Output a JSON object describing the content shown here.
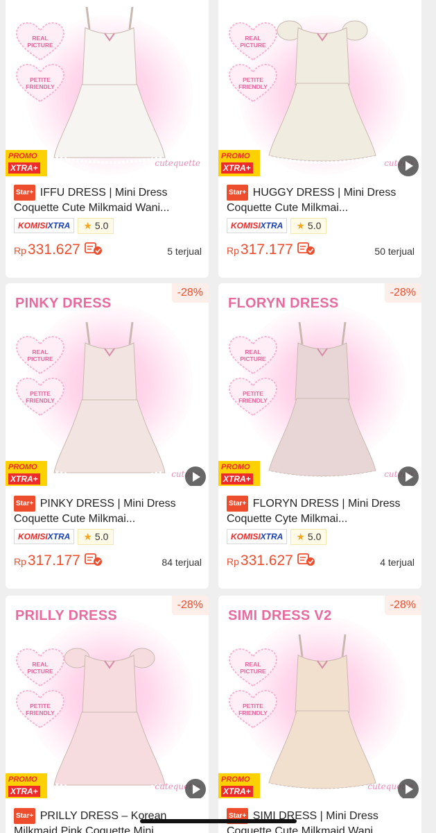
{
  "products": [
    {
      "overlay_title": "",
      "discount": "",
      "hearts": [
        "REAL\nPICTURE",
        "PETITE\nFRIENDLY"
      ],
      "promo_line1": "PROMO",
      "promo_line2": "XTRA+",
      "brand": "cutequette",
      "badge": "Star+",
      "name": "IFFU DRESS | Mini Dress Coquette Cute Milkmaid Wani...",
      "komisi_a": "KOMISI",
      "komisi_b": "XTRA",
      "rating": "5.0",
      "currency": "Rp",
      "price": "331.627",
      "sold": "5 terjual",
      "dress_color": "#f7f5f2",
      "has_video": false
    },
    {
      "overlay_title": "",
      "discount": "",
      "hearts": [
        "REAL\nPICTURE",
        "PETITE\nFRIENDLY"
      ],
      "promo_line1": "PROMO",
      "promo_line2": "XTRA+",
      "brand": "cutequ",
      "badge": "Star+",
      "name": "HUGGY DRESS | Mini Dress Coquette Cute Milkmai...",
      "komisi_a": "KOMISI",
      "komisi_b": "XTRA",
      "rating": "5.0",
      "currency": "Rp",
      "price": "317.177",
      "sold": "50 terjual",
      "dress_color": "#f1ece0",
      "has_video": true
    },
    {
      "overlay_title": "PINKY DRESS",
      "discount": "-28%",
      "hearts": [
        "REAL\nPICTURE",
        "PETITE\nFRIENDLY"
      ],
      "promo_line1": "PROMO",
      "promo_line2": "XTRA+",
      "brand": "cutequ",
      "badge": "Star+",
      "name": "PINKY DRESS | Mini Dress Coquette Cute Milkmai...",
      "komisi_a": "KOMISI",
      "komisi_b": "XTRA",
      "rating": "5.0",
      "currency": "Rp",
      "price": "317.177",
      "sold": "84 terjual",
      "dress_color": "#f2e4e0",
      "has_video": true
    },
    {
      "overlay_title": "FLORYN DRESS",
      "discount": "-28%",
      "hearts": [
        "REAL\nPICTURE",
        "PETITE\nFRIENDLY"
      ],
      "promo_line1": "PROMO",
      "promo_line2": "XTRA+",
      "brand": "cutequ",
      "badge": "Star+",
      "name": "FLORYN DRESS | Mini Dress Coquette Cyte Milkmai...",
      "komisi_a": "KOMISI",
      "komisi_b": "XTRA",
      "rating": "5.0",
      "currency": "Rp",
      "price": "331.627",
      "sold": "4 terjual",
      "dress_color": "#e8d6d6",
      "has_video": true
    },
    {
      "overlay_title": "PRILLY DRESS",
      "discount": "-28%",
      "hearts": [
        "REAL\nPICTURE",
        "PETITE\nFRIENDLY"
      ],
      "promo_line1": "PROMO",
      "promo_line2": "XTRA+",
      "brand": "cutequette",
      "badge": "Star+",
      "name": "PRILLY DRESS – Korean Milkmaid Pink Coquette Mini...",
      "komisi_a": "",
      "komisi_b": "",
      "rating": "",
      "currency": "",
      "price": "",
      "sold": "",
      "dress_color": "#f6dcdf",
      "has_video": true
    },
    {
      "overlay_title": "SIMI DRESS V2",
      "discount": "-28%",
      "hearts": [
        "REAL\nPICTURE",
        "PETITE\nFRIENDLY"
      ],
      "promo_line1": "PROMO",
      "promo_line2": "XTRA+",
      "brand": "cutequette",
      "badge": "Star+",
      "name": "SIMI DRESS | Mini Dress Coquette Cute Milkmaid Wani...",
      "komisi_a": "",
      "komisi_b": "",
      "rating": "",
      "currency": "",
      "price": "",
      "sold": "",
      "dress_color": "#f2e0cf",
      "has_video": true
    }
  ],
  "colors": {
    "accent": "#ee4d2d",
    "promo_yellow": "#ffd100",
    "pink_title": "#e86a9f"
  },
  "icons": [
    "play-icon",
    "cod-icon",
    "star-icon",
    "heart-badge-icon"
  ]
}
